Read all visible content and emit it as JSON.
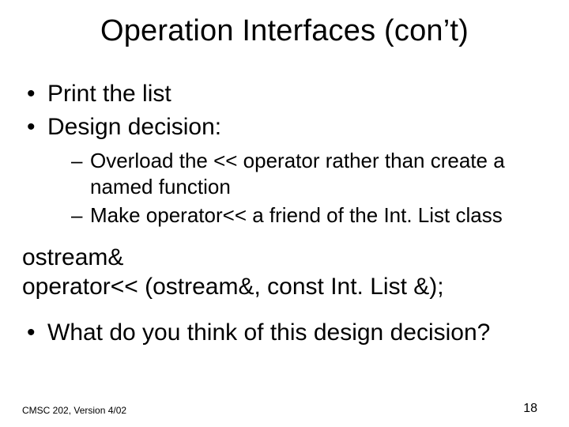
{
  "title": "Operation Interfaces (con’t)",
  "bullets": {
    "b1": "Print the list",
    "b2": "Design decision:",
    "sub1": "Overload the << operator rather than create a named function",
    "sub2": "Make operator<< a friend of the Int. List class",
    "b3": "What do you think of this design decision?"
  },
  "code": {
    "line1": "ostream&",
    "line2": "operator<< (ostream&, const Int. List &);"
  },
  "footer": {
    "left": "CMSC 202, Version 4/02",
    "page": "18"
  }
}
